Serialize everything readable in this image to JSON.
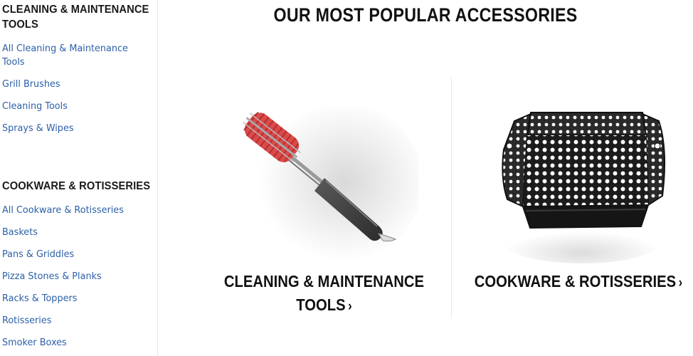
{
  "sidebar": {
    "sections": [
      {
        "title": "CLEANING & MAINTENANCE TOOLS",
        "links": [
          "All Cleaning & Maintenance Tools",
          "Grill Brushes",
          "Cleaning Tools",
          "Sprays & Wipes"
        ]
      },
      {
        "title": "COOKWARE & ROTISSERIES",
        "links": [
          "All Cookware & Rotisseries",
          "Baskets",
          "Pans & Griddles",
          "Pizza Stones & Planks",
          "Racks & Toppers",
          "Rotisseries",
          "Smoker Boxes"
        ]
      }
    ]
  },
  "main": {
    "heading": "OUR MOST POPULAR ACCESSORIES",
    "cards": [
      {
        "label_line1": "CLEANING & MAINTENANCE",
        "label_line2": "TOOLS",
        "icon": "grill-brush-image"
      },
      {
        "label": "COOKWARE & ROTISSERIES",
        "icon": "grill-basket-image"
      }
    ],
    "chevron": "›"
  },
  "colors": {
    "link": "#2b5fa8",
    "heading": "#111111",
    "divider": "#e8e8e8"
  }
}
